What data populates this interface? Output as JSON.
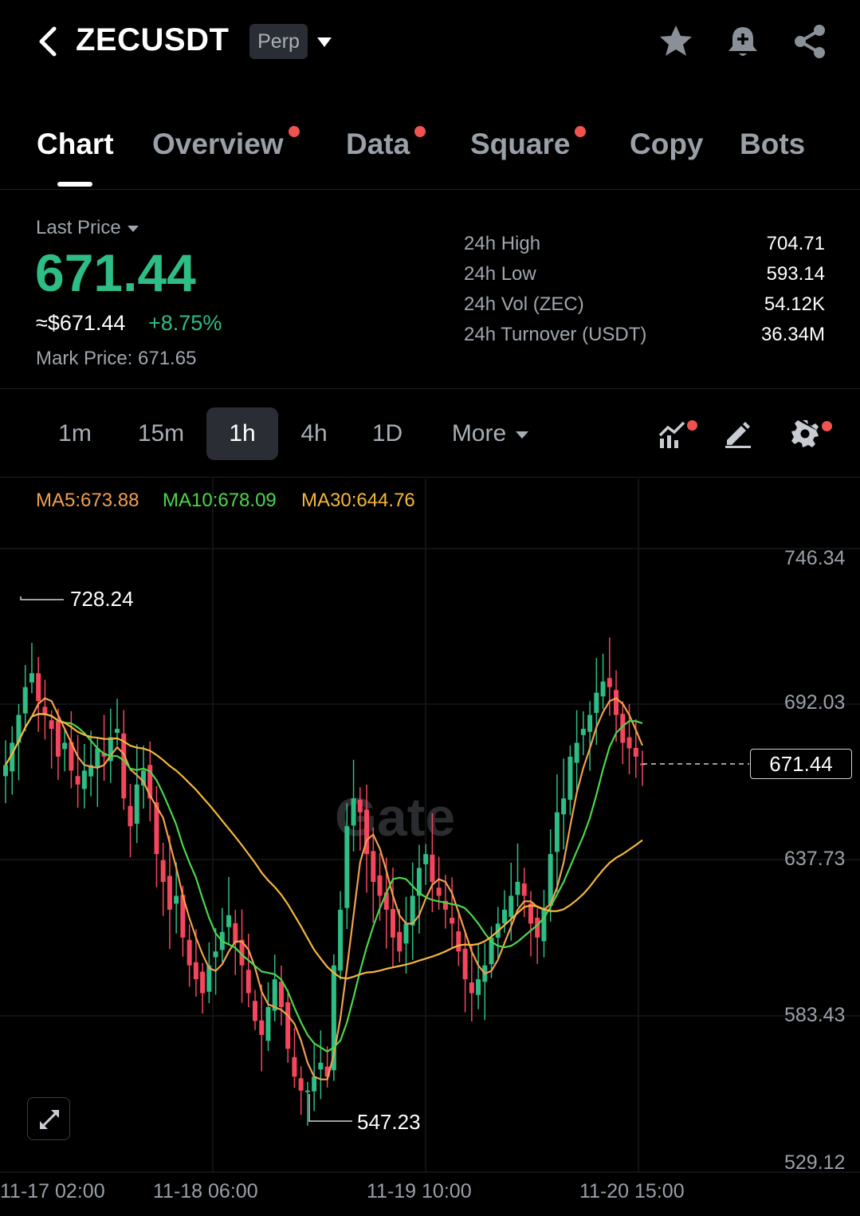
{
  "header": {
    "symbol": "ZECUSDT",
    "badge": "Perp",
    "icons": [
      "back-icon",
      "star-icon",
      "bell-icon",
      "share-icon"
    ]
  },
  "tabs": [
    {
      "label": "Chart",
      "active": true,
      "dot": false
    },
    {
      "label": "Overview",
      "active": false,
      "dot": true
    },
    {
      "label": "Data",
      "active": false,
      "dot": true
    },
    {
      "label": "Square",
      "active": false,
      "dot": true
    },
    {
      "label": "Copy",
      "active": false,
      "dot": false
    },
    {
      "label": "Bots",
      "active": false,
      "dot": false
    }
  ],
  "price": {
    "label": "Last Price",
    "last": "671.44",
    "usd": "≈$671.44",
    "change": "+8.75%",
    "mark": "Mark Price:  671.65"
  },
  "stats": [
    {
      "label": "24h High",
      "value": "704.71"
    },
    {
      "label": "24h Low",
      "value": "593.14"
    },
    {
      "label": "24h Vol (ZEC)",
      "value": "54.12K"
    },
    {
      "label": "24h Turnover (USDT)",
      "value": "36.34M"
    }
  ],
  "intervals": [
    {
      "label": "1m",
      "active": false
    },
    {
      "label": "15m",
      "active": false
    },
    {
      "label": "1h",
      "active": true
    },
    {
      "label": "4h",
      "active": false
    },
    {
      "label": "1D",
      "active": false
    }
  ],
  "more_label": "More",
  "ma": [
    {
      "label": "MA5:673.88",
      "color": "#f0a050"
    },
    {
      "label": "MA10:678.09",
      "color": "#4cd64c"
    },
    {
      "label": "MA30:644.76",
      "color": "#f5b73b"
    }
  ],
  "chart_data": {
    "type": "candlestick",
    "y_ticks": [
      "746.34",
      "692.03",
      "637.73",
      "583.43",
      "529.12"
    ],
    "x_ticks": [
      "11-17 02:00",
      "11-18 06:00",
      "11-19 10:00",
      "11-20 15:00"
    ],
    "ylim": [
      529.12,
      746.34
    ],
    "current_price": "671.44",
    "high_annotation": "728.24",
    "low_annotation": "547.23",
    "watermark": "Gate",
    "colors": {
      "up": "#2ebd85",
      "down": "#f6465d",
      "ma5": "#f0a050",
      "ma10": "#4cd64c",
      "ma30": "#f5b73b"
    },
    "closes": [
      672,
      680,
      690,
      700,
      705,
      695,
      690,
      685,
      675,
      680,
      670,
      665,
      670,
      672,
      678,
      675,
      682,
      685,
      660,
      650,
      665,
      670,
      660,
      640,
      630,
      620,
      625,
      610,
      600,
      595,
      590,
      600,
      605,
      612,
      618,
      608,
      600,
      590,
      580,
      575,
      585,
      595,
      585,
      570,
      560,
      555,
      555,
      560,
      565,
      560,
      600,
      620,
      650,
      660,
      655,
      640,
      630,
      625,
      620,
      610,
      605,
      615,
      625,
      635,
      640,
      630,
      625,
      620,
      615,
      605,
      595,
      590,
      595,
      600,
      610,
      615,
      620,
      625,
      630,
      625,
      615,
      610,
      620,
      640,
      655,
      660,
      675,
      680,
      685,
      690,
      698,
      702,
      700,
      690,
      680,
      678,
      675,
      672
    ]
  }
}
